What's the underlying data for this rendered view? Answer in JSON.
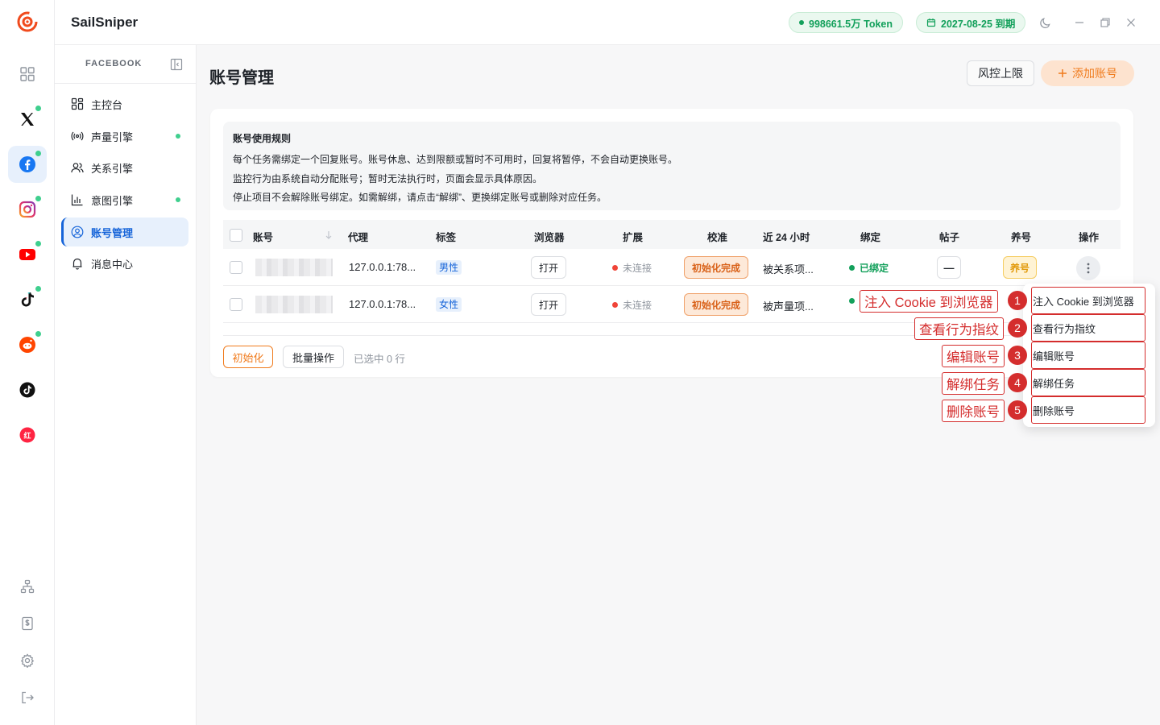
{
  "app": {
    "name": "SailSniper",
    "token_pill": "998661.5万 Token",
    "expiry_pill": "2027-08-25 到期"
  },
  "rail": {
    "items": [
      "dashboard-grid-icon",
      "x-icon",
      "facebook-icon",
      "instagram-icon",
      "youtube-icon",
      "tiktok-icon",
      "reddit-icon",
      "tiktok-alt-icon",
      "xiaohongshu-icon"
    ],
    "active": "facebook-icon",
    "bottom": [
      "org-tree-icon",
      "billing-icon",
      "settings-icon",
      "logout-icon"
    ]
  },
  "sidebar": {
    "title": "FACEBOOK",
    "items": [
      {
        "label": "主控台",
        "icon": "dashboard-grid-icon",
        "dot": false
      },
      {
        "label": "声量引擎",
        "icon": "broadcast-icon",
        "dot": true
      },
      {
        "label": "关系引擎",
        "icon": "users-icon",
        "dot": false
      },
      {
        "label": "意图引擎",
        "icon": "bar-chart-icon",
        "dot": true
      },
      {
        "label": "账号管理",
        "icon": "user-circle-icon",
        "dot": false,
        "active": true
      },
      {
        "label": "消息中心",
        "icon": "bell-icon",
        "dot": false
      }
    ]
  },
  "main": {
    "title": "账号管理",
    "risk_button": "风控上限",
    "add_button": "添加账号",
    "rules": {
      "title": "账号使用规则",
      "lines": [
        "每个任务需绑定一个回复账号。账号休息、达到限额或暂时不可用时，回复将暂停，不会自动更换账号。",
        "监控行为由系统自动分配账号；暂时无法执行时，页面会显示具体原因。",
        "停止项目不会解除账号绑定。如需解绑，请点击“解绑”、更换绑定账号或删除对应任务。"
      ]
    },
    "table": {
      "headers": [
        "账号",
        "代理",
        "标签",
        "浏览器",
        "扩展",
        "校准",
        "近 24 小时",
        "绑定",
        "帖子",
        "养号",
        "操作"
      ],
      "rows": [
        {
          "proxy": "127.0.0.1:78...",
          "tag": "男性",
          "browser": "打开",
          "extension": "未连接",
          "calibration": "初始化完成",
          "last24h": "被关系项...",
          "binding": "已绑定",
          "posts": "—",
          "nurture": "养号"
        },
        {
          "proxy": "127.0.0.1:78...",
          "tag": "女性",
          "browser": "打开",
          "extension": "未连接",
          "calibration": "初始化完成",
          "last24h": "被声量项..."
        }
      ]
    },
    "footer": {
      "init_button": "初始化",
      "batch_button": "批量操作",
      "selected_text": "已选中 0 行"
    }
  },
  "menu": {
    "items": [
      "注入 Cookie 到浏览器",
      "查看行为指纹",
      "编辑账号",
      "解绑任务",
      "删除账号"
    ],
    "callout_numbers": [
      "1",
      "2",
      "3",
      "4",
      "5"
    ]
  },
  "colors": {
    "primary": "#1664d9",
    "accent_orange": "#f07b1d",
    "success": "#13a05b",
    "danger": "#f04438",
    "annotation_red": "#d42d2d"
  }
}
